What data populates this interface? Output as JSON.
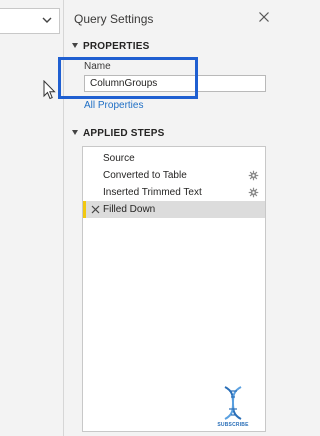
{
  "query_settings": {
    "title": "Query Settings",
    "properties": {
      "heading": "PROPERTIES",
      "name_label": "Name",
      "name_value": "ColumnGroups",
      "all_properties_link": "All Properties"
    },
    "applied_steps": {
      "heading": "APPLIED STEPS",
      "steps": [
        {
          "label": "Source",
          "has_gear": false,
          "selected": false
        },
        {
          "label": "Converted to Table",
          "has_gear": true,
          "selected": false
        },
        {
          "label": "Inserted Trimmed Text",
          "has_gear": true,
          "selected": false
        },
        {
          "label": "Filled Down",
          "has_gear": false,
          "selected": true
        }
      ]
    }
  },
  "watermark": {
    "label": "SUBSCRIBE"
  },
  "colors": {
    "accent_highlight": "#1f5fd1",
    "link": "#1f6fc5",
    "selected_step_marker": "#f2c811"
  }
}
